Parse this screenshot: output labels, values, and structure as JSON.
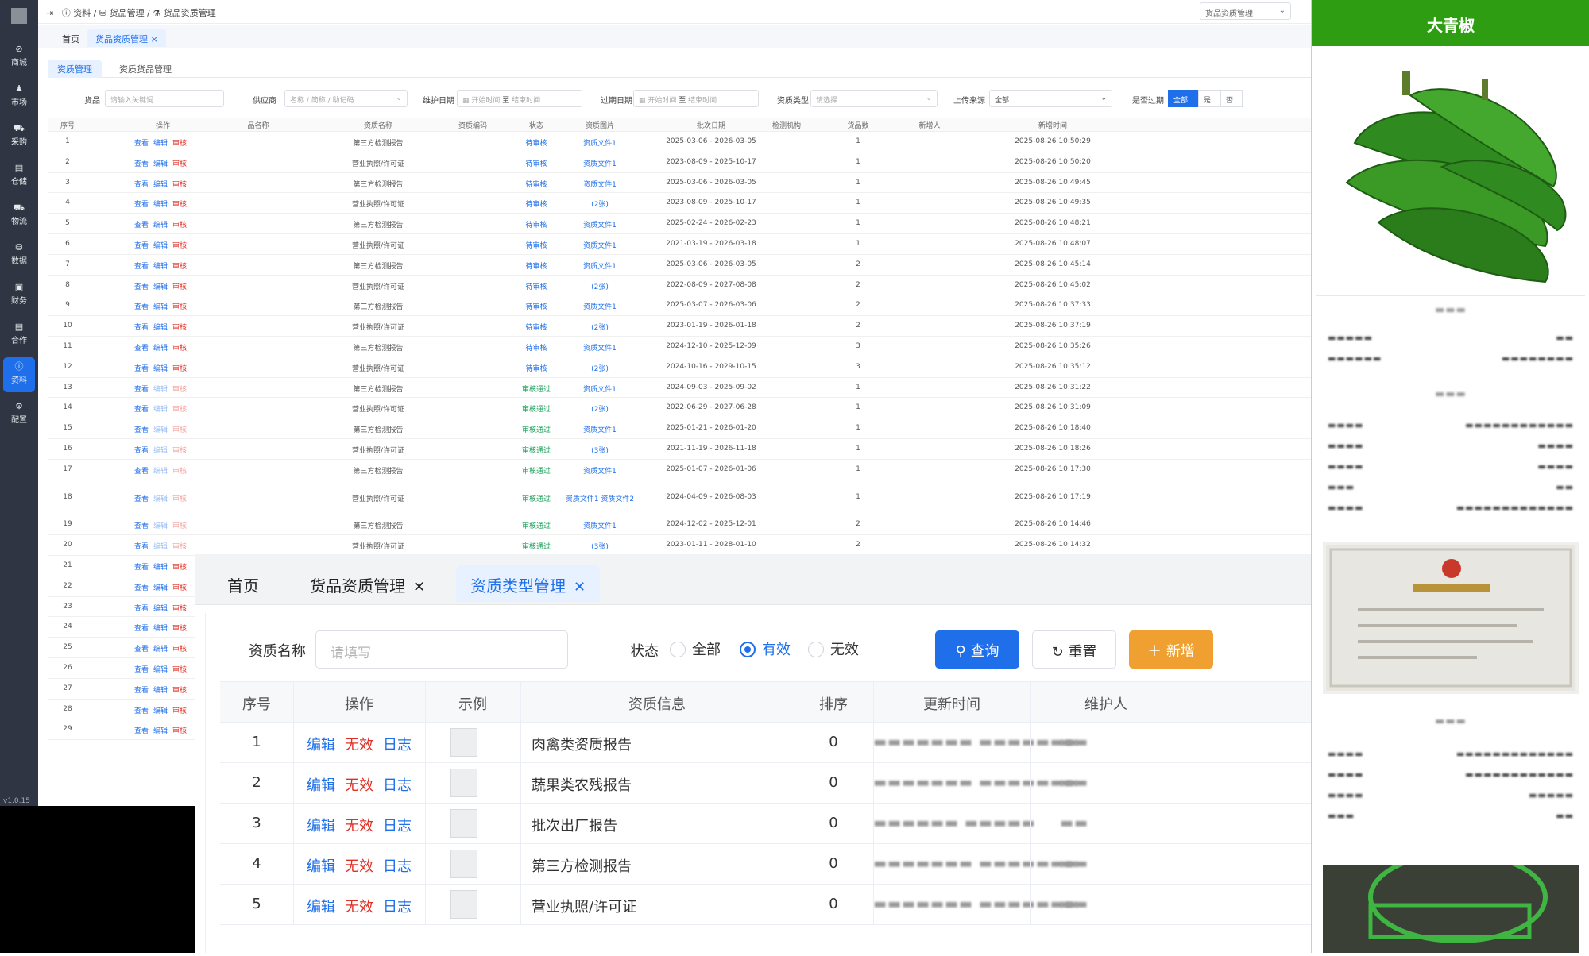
{
  "header": {
    "crumbs": [
      "资料",
      "货品管理",
      "货品资质管理"
    ],
    "select_value": "货品资质管理"
  },
  "nav": {
    "items": [
      {
        "label": "商城"
      },
      {
        "label": "市场"
      },
      {
        "label": "采购"
      },
      {
        "label": "仓储"
      },
      {
        "label": "物流"
      },
      {
        "label": "数据"
      },
      {
        "label": "财务"
      },
      {
        "label": "合作"
      },
      {
        "label": "资料",
        "active": true
      },
      {
        "label": "配置"
      }
    ],
    "version": "v1.0.15"
  },
  "page_tabs": [
    "首页",
    "货品资质管理"
  ],
  "sub_tabs": [
    "资质管理",
    "资质货品管理"
  ],
  "filters": {
    "goods_label": "货品",
    "goods_placeholder": "请输入关键词",
    "supplier_label": "供应商",
    "supplier_placeholder": "名称 / 简称 / 助记码",
    "maintain_label": "维护日期",
    "start_ph": "开始时间",
    "to": "至",
    "end_ph": "结束时间",
    "expire_label": "过期日期",
    "type_label": "资质类型",
    "type_placeholder": "请选择",
    "source_label": "上传来源",
    "source_value": "全部",
    "expired_label": "是否过期",
    "expired_options": [
      "全部",
      "是",
      "否"
    ]
  },
  "main_table": {
    "columns": [
      "序号",
      "操作",
      "品名称",
      "资质名称",
      "资质编码",
      "状态",
      "资质图片",
      "批次日期",
      "检测机构",
      "货品数",
      "新增人",
      "新增时间"
    ],
    "actions": [
      "查看",
      "编辑",
      "审核"
    ],
    "rows": [
      {
        "n": "1",
        "name": "第三方检测报告",
        "status": "待审核",
        "img": "资质文件1",
        "date": "2025-03-06 - 2026-03-05",
        "count": "1",
        "time": "2025-08-26 10:50:29"
      },
      {
        "n": "2",
        "name": "营业执照/许可证",
        "status": "待审核",
        "img": "资质文件1",
        "date": "2023-08-09 - 2025-10-17",
        "count": "1",
        "time": "2025-08-26 10:50:20"
      },
      {
        "n": "3",
        "name": "第三方检测报告",
        "status": "待审核",
        "img": "资质文件1",
        "date": "2025-03-06 - 2026-03-05",
        "count": "1",
        "time": "2025-08-26 10:49:45"
      },
      {
        "n": "4",
        "name": "营业执照/许可证",
        "status": "待审核",
        "img": "(2张)",
        "date": "2023-08-09 - 2025-10-17",
        "count": "1",
        "time": "2025-08-26 10:49:35"
      },
      {
        "n": "5",
        "name": "第三方检测报告",
        "status": "待审核",
        "img": "资质文件1",
        "date": "2025-02-24 - 2026-02-23",
        "count": "1",
        "time": "2025-08-26 10:48:21"
      },
      {
        "n": "6",
        "name": "营业执照/许可证",
        "status": "待审核",
        "img": "资质文件1",
        "date": "2021-03-19 - 2026-03-18",
        "count": "1",
        "time": "2025-08-26 10:48:07"
      },
      {
        "n": "7",
        "name": "第三方检测报告",
        "status": "待审核",
        "img": "资质文件1",
        "date": "2025-03-06 - 2026-03-05",
        "count": "2",
        "time": "2025-08-26 10:45:14"
      },
      {
        "n": "8",
        "name": "营业执照/许可证",
        "status": "待审核",
        "img": "(2张)",
        "date": "2022-08-09 - 2027-08-08",
        "count": "2",
        "time": "2025-08-26 10:45:02"
      },
      {
        "n": "9",
        "name": "第三方检测报告",
        "status": "待审核",
        "img": "资质文件1",
        "date": "2025-03-07 - 2026-03-06",
        "count": "2",
        "time": "2025-08-26 10:37:33"
      },
      {
        "n": "10",
        "name": "营业执照/许可证",
        "status": "待审核",
        "img": "(2张)",
        "date": "2023-01-19 - 2026-01-18",
        "count": "2",
        "time": "2025-08-26 10:37:19"
      },
      {
        "n": "11",
        "name": "第三方检测报告",
        "status": "待审核",
        "img": "资质文件1",
        "date": "2024-12-10 - 2025-12-09",
        "count": "3",
        "time": "2025-08-26 10:35:26"
      },
      {
        "n": "12",
        "name": "营业执照/许可证",
        "status": "待审核",
        "img": "(2张)",
        "date": "2024-10-16 - 2029-10-15",
        "count": "3",
        "time": "2025-08-26 10:35:12"
      },
      {
        "n": "13",
        "name": "第三方检测报告",
        "status": "审核通过",
        "img": "资质文件1",
        "date": "2024-09-03 - 2025-09-02",
        "count": "1",
        "time": "2025-08-26 10:31:22"
      },
      {
        "n": "14",
        "name": "营业执照/许可证",
        "status": "审核通过",
        "img": "(2张)",
        "date": "2022-06-29 - 2027-06-28",
        "count": "1",
        "time": "2025-08-26 10:31:09"
      },
      {
        "n": "15",
        "name": "第三方检测报告",
        "status": "审核通过",
        "img": "资质文件1",
        "date": "2025-01-21 - 2026-01-20",
        "count": "1",
        "time": "2025-08-26 10:18:40"
      },
      {
        "n": "16",
        "name": "营业执照/许可证",
        "status": "审核通过",
        "img": "(3张)",
        "date": "2021-11-19 - 2026-11-18",
        "count": "1",
        "time": "2025-08-26 10:18:26"
      },
      {
        "n": "17",
        "name": "第三方检测报告",
        "status": "审核通过",
        "img": "资质文件1",
        "date": "2025-01-07 - 2026-01-06",
        "count": "1",
        "time": "2025-08-26 10:17:30"
      },
      {
        "n": "18",
        "name": "营业执照/许可证",
        "status": "审核通过",
        "img": "资质文件1 资质文件2",
        "date": "2024-04-09 - 2026-08-03",
        "count": "1",
        "time": "2025-08-26 10:17:19"
      },
      {
        "n": "19",
        "name": "第三方检测报告",
        "status": "审核通过",
        "img": "资质文件1",
        "date": "2024-12-02 - 2025-12-01",
        "count": "2",
        "time": "2025-08-26 10:14:46"
      },
      {
        "n": "20",
        "name": "营业执照/许可证",
        "status": "审核通过",
        "img": "(3张)",
        "date": "2023-01-11 - 2028-01-10",
        "count": "2",
        "time": "2025-08-26 10:14:32"
      },
      {
        "n": "21"
      },
      {
        "n": "22"
      },
      {
        "n": "23"
      },
      {
        "n": "24"
      },
      {
        "n": "25"
      },
      {
        "n": "26"
      },
      {
        "n": "27"
      },
      {
        "n": "28"
      },
      {
        "n": "29"
      }
    ]
  },
  "overlay": {
    "tabs": [
      "首页",
      "货品资质管理",
      "资质类型管理"
    ],
    "name_label": "资质名称",
    "name_placeholder": "请填写",
    "status_label": "状态",
    "status_options": [
      "全部",
      "有效",
      "无效"
    ],
    "status_selected": "有效",
    "query_label": "查询",
    "reset_label": "重置",
    "add_label": "新增",
    "columns": [
      "序号",
      "操作",
      "示例",
      "资质信息",
      "排序",
      "更新时间",
      "维护人"
    ],
    "row_actions": [
      "编辑",
      "无效",
      "日志"
    ],
    "rows": [
      {
        "n": "1",
        "info": "肉禽类资质报告",
        "sort": "0"
      },
      {
        "n": "2",
        "info": "蔬果类农残报告",
        "sort": "0"
      },
      {
        "n": "3",
        "info": "批次出厂报告",
        "sort": "0"
      },
      {
        "n": "4",
        "info": "第三方检测报告",
        "sort": "0"
      },
      {
        "n": "5",
        "info": "营业执照/许可证",
        "sort": "0"
      }
    ]
  },
  "right_panel": {
    "title": "大青椒"
  },
  "colors": {
    "primary": "#1f6feb",
    "danger": "#e02e24",
    "success": "#18a058",
    "warning": "#f0a030",
    "brand_green": "#2e9d12",
    "nav_bg": "#2f3542"
  }
}
